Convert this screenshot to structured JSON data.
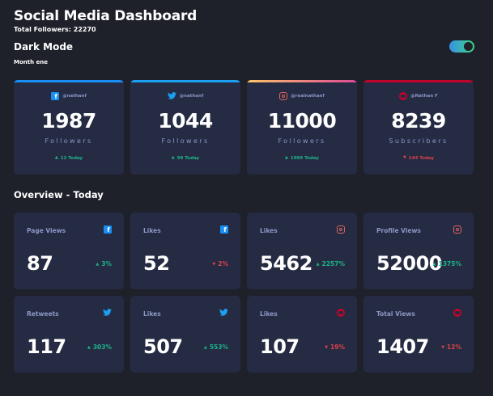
{
  "header": {
    "title": "Social Media Dashboard",
    "total_followers": "Total Followers: 22270",
    "dark_mode_label": "Dark Mode",
    "month_label": "Month ene",
    "toggle_on": true
  },
  "colors": {
    "background": "#1e202a",
    "card": "#252b43",
    "muted_text": "#8b97c6",
    "up": "#1db489",
    "down": "#dc414c",
    "facebook": "#198ff5",
    "twitter": "#1ca0f2",
    "instagram_from": "#fdc468",
    "instagram_to": "#df4996",
    "youtube": "#c4032a"
  },
  "follower_cards": [
    {
      "platform": "facebook",
      "icon": "facebook-icon",
      "handle": "@nathanf",
      "count": "1987",
      "unit": "Followers",
      "today": "12 Today",
      "trend": "up"
    },
    {
      "platform": "twitter",
      "icon": "twitter-icon",
      "handle": "@nathanf",
      "count": "1044",
      "unit": "Followers",
      "today": "99 Today",
      "trend": "up"
    },
    {
      "platform": "instagram",
      "icon": "instagram-icon",
      "handle": "@realnathanf",
      "count": "11000",
      "unit": "Followers",
      "today": "1099 Today",
      "trend": "up"
    },
    {
      "platform": "youtube",
      "icon": "youtube-icon",
      "handle": "@Nathan F",
      "count": "8239",
      "unit": "Subscribers",
      "today": "144 Today",
      "trend": "down"
    }
  ],
  "overview": {
    "title": "Overview - Today",
    "cards": [
      {
        "label": "Page Views",
        "icon": "facebook-icon",
        "value": "87",
        "percent": "3%",
        "trend": "up"
      },
      {
        "label": "Likes",
        "icon": "facebook-icon",
        "value": "52",
        "percent": "2%",
        "trend": "down"
      },
      {
        "label": "Likes",
        "icon": "instagram-icon",
        "value": "5462",
        "percent": "2257%",
        "trend": "up"
      },
      {
        "label": "Profile Views",
        "icon": "instagram-icon",
        "value": "52000",
        "percent": "1375%",
        "trend": "up"
      },
      {
        "label": "Retweets",
        "icon": "twitter-icon",
        "value": "117",
        "percent": "303%",
        "trend": "up"
      },
      {
        "label": "Likes",
        "icon": "twitter-icon",
        "value": "507",
        "percent": "553%",
        "trend": "up"
      },
      {
        "label": "Likes",
        "icon": "youtube-icon",
        "value": "107",
        "percent": "19%",
        "trend": "down"
      },
      {
        "label": "Total Views",
        "icon": "youtube-icon",
        "value": "1407",
        "percent": "12%",
        "trend": "down"
      }
    ]
  }
}
